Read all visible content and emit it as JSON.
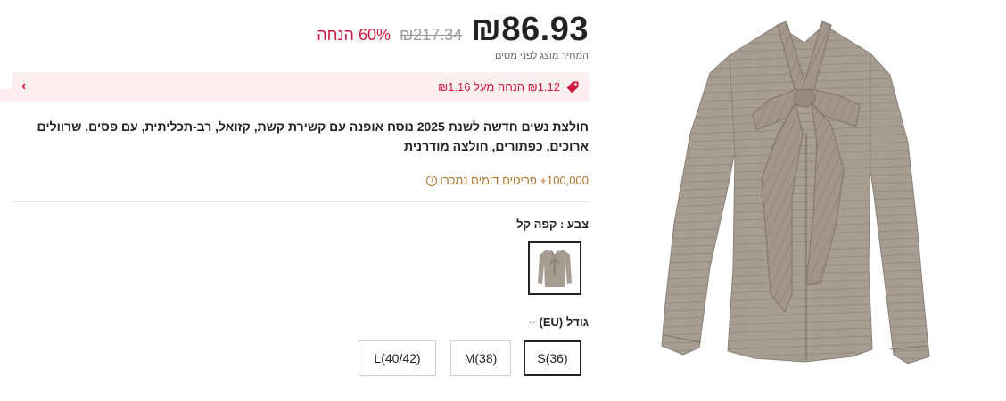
{
  "price": {
    "current": "₪86.93",
    "original": "₪217.34",
    "discount": "60% הנחה",
    "tax_note": "המחיר מוצג לפני מסים"
  },
  "promo": {
    "text": "₪1.12 הנחה מעל ₪1.16",
    "icon": "price-tag-icon",
    "accent": "#d0183e"
  },
  "product": {
    "title": "חולצת נשים חדשה לשנת 2025 נוסח אופנה עם קשירת קשת, קזואל, רב-תכליתית, עם פסים, שרוולים ארוכים, כפתורים, חולצה מודרנית",
    "sold": "100,000+ פריטים דומים נמכרו"
  },
  "color": {
    "label": "צבע : קפה קל"
  },
  "size": {
    "label": "גודל (EU)",
    "options": [
      "S(36)",
      "M(38)",
      "L(40/42)"
    ],
    "selected": "S(36)"
  },
  "colors": {
    "accent": "#d0183e",
    "sold_text": "#b0742c",
    "promo_bg": "#fdeff0",
    "garment": "#a59a8f"
  }
}
